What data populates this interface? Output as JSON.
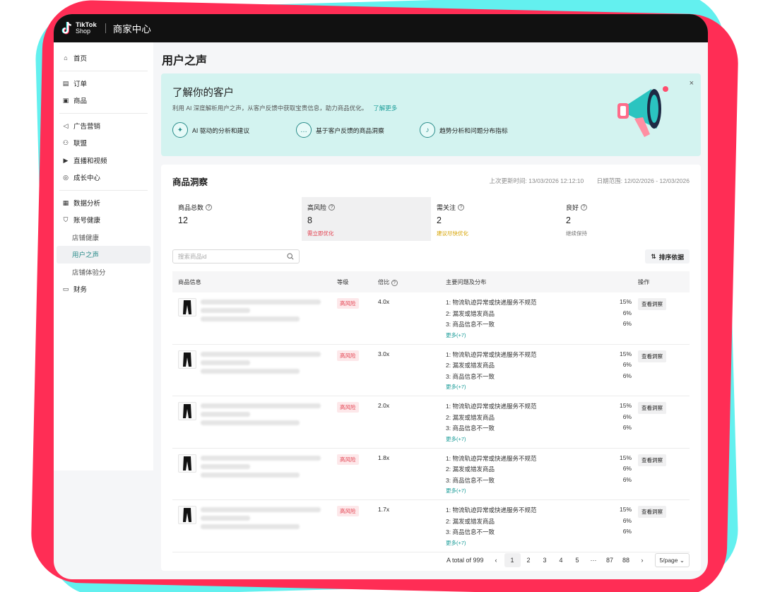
{
  "brand": {
    "logo_line1": "TikTok",
    "logo_line2": "Shop",
    "title": "商家中心"
  },
  "sidebar": {
    "items": [
      {
        "label": "首页",
        "icon": "home-icon"
      },
      {
        "label": "订单",
        "icon": "order-icon"
      },
      {
        "label": "商品",
        "icon": "product-icon"
      },
      {
        "label": "广告营销",
        "icon": "megaphone-icon"
      },
      {
        "label": "联盟",
        "icon": "affiliate-icon"
      },
      {
        "label": "直播和视频",
        "icon": "video-icon"
      },
      {
        "label": "成长中心",
        "icon": "growth-icon"
      },
      {
        "label": "数据分析",
        "icon": "chart-icon"
      },
      {
        "label": "账号健康",
        "icon": "shield-icon"
      },
      {
        "label": "店铺健康",
        "icon": ""
      },
      {
        "label": "用户之声",
        "icon": ""
      },
      {
        "label": "店铺体验分",
        "icon": ""
      },
      {
        "label": "财务",
        "icon": "wallet-icon"
      }
    ]
  },
  "page": {
    "title": "用户之声"
  },
  "banner": {
    "title": "了解你的客户",
    "desc": "利用 AI 深度解析用户之声，从客户反馈中获取宝贵信息，助力商品优化。",
    "learn_more": "了解更多",
    "features": [
      {
        "label": "AI 驱动的分析和建议",
        "icon": "sparkle-icon"
      },
      {
        "label": "基于客户反馈的商品洞察",
        "icon": "chat-icon"
      },
      {
        "label": "趋势分析和问题分布指标",
        "icon": "bell-icon"
      }
    ],
    "close": "×"
  },
  "insight": {
    "title": "商品洞察",
    "last_update": "上次更新时间: 13/03/2026 12:12:10",
    "date_range": "日期范围: 12/02/2026 - 12/03/2026",
    "stats": [
      {
        "label": "商品总数",
        "value": "12",
        "sub": "",
        "sub_color": ""
      },
      {
        "label": "高风险",
        "value": "8",
        "sub": "需立即优化",
        "sub_color": "#e23b4a"
      },
      {
        "label": "需关注",
        "value": "2",
        "sub": "建议尽快优化",
        "sub_color": "#d6a300"
      },
      {
        "label": "良好",
        "value": "2",
        "sub": "继续保持",
        "sub_color": "#777777"
      }
    ],
    "search_placeholder": "搜索商品id",
    "sort_label": "排序依据",
    "columns": {
      "product": "商品信息",
      "level": "等级",
      "ratio": "倍比",
      "issues": "主要问题及分布",
      "op": "操作"
    },
    "rows": [
      {
        "level": "高风险",
        "ratio": "4.0x",
        "issues": [
          {
            "t": "1: 物流轨迹异常或快递服务不规范",
            "p": "15%"
          },
          {
            "t": "2: 漏发或错发商品",
            "p": "6%"
          },
          {
            "t": "3: 商品信息不一致",
            "p": "6%"
          }
        ],
        "more": "更多(+7)",
        "op": "查看洞察"
      },
      {
        "level": "高风险",
        "ratio": "3.0x",
        "issues": [
          {
            "t": "1: 物流轨迹异常或快递服务不规范",
            "p": "15%"
          },
          {
            "t": "2: 漏发或错发商品",
            "p": "6%"
          },
          {
            "t": "3: 商品信息不一致",
            "p": "6%"
          }
        ],
        "more": "更多(+7)",
        "op": "查看洞察"
      },
      {
        "level": "高风险",
        "ratio": "2.0x",
        "issues": [
          {
            "t": "1: 物流轨迹异常或快递服务不规范",
            "p": "15%"
          },
          {
            "t": "2: 漏发或错发商品",
            "p": "6%"
          },
          {
            "t": "3: 商品信息不一致",
            "p": "6%"
          }
        ],
        "more": "更多(+7)",
        "op": "查看洞察"
      },
      {
        "level": "高风险",
        "ratio": "1.8x",
        "issues": [
          {
            "t": "1: 物流轨迹异常或快递服务不规范",
            "p": "15%"
          },
          {
            "t": "2: 漏发或错发商品",
            "p": "6%"
          },
          {
            "t": "3: 商品信息不一致",
            "p": "6%"
          }
        ],
        "more": "更多(+7)",
        "op": "查看洞察"
      },
      {
        "level": "高风险",
        "ratio": "1.7x",
        "issues": [
          {
            "t": "1: 物流轨迹异常或快递服务不规范",
            "p": "15%"
          },
          {
            "t": "2: 漏发或错发商品",
            "p": "6%"
          },
          {
            "t": "3: 商品信息不一致",
            "p": "6%"
          }
        ],
        "more": "更多(+7)",
        "op": "查看洞察"
      }
    ],
    "pager": {
      "total": "A total of 999",
      "pages": [
        "1",
        "2",
        "3",
        "4",
        "5",
        "···",
        "87",
        "88"
      ],
      "per_page": "5/page"
    }
  },
  "colors": {
    "accent": "#1a9c98",
    "danger": "#e23b4a",
    "warn": "#d6a300"
  }
}
